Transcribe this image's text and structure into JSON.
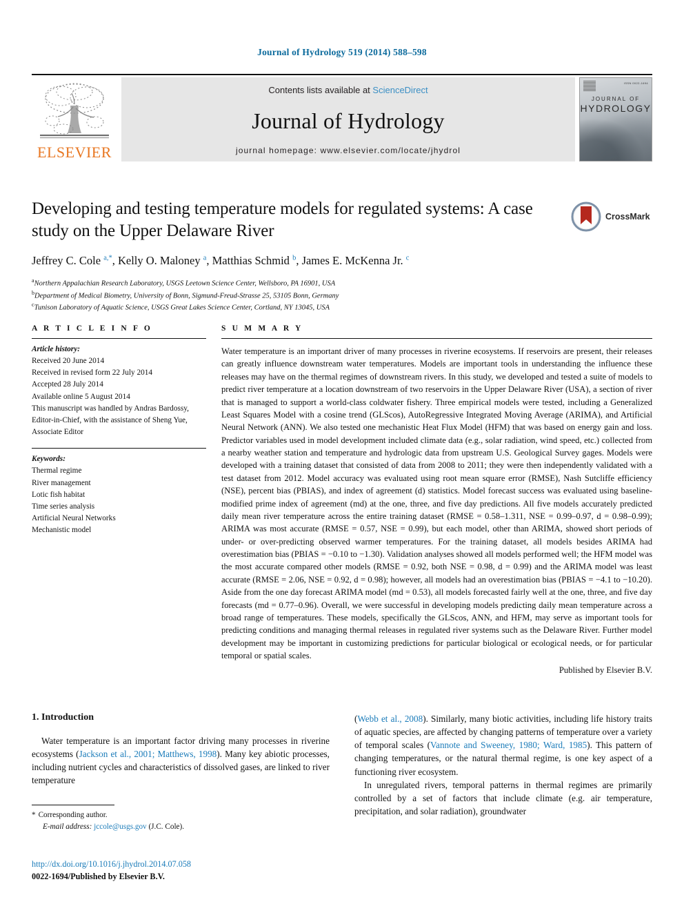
{
  "running_head": "Journal of Hydrology 519 (2014) 588–598",
  "masthead": {
    "contents_prefix": "Contents lists available at",
    "sciencedirect": "ScienceDirect",
    "journal_name": "Journal of Hydrology",
    "homepage": "journal homepage: www.elsevier.com/locate/jhydrol",
    "publisher_logo_text": "ELSEVIER",
    "cover": {
      "line1": "JOURNAL OF",
      "line2": "HYDROLOGY",
      "code": "ISSN 0022-1694"
    },
    "link_color": "#3b8fc4",
    "elsevier_orange": "#E87722"
  },
  "article": {
    "title": "Developing and testing temperature models for regulated systems: A case study on the Upper Delaware River",
    "authors_html": "Jeffrey C. Cole <sup>a,*</sup>, Kelly O. Maloney <sup>a</sup>, Matthias Schmid <sup>b</sup>, James E. McKenna Jr. <sup>c</sup>",
    "affiliations": [
      {
        "marker": "a",
        "text": "Northern Appalachian Research Laboratory, USGS Leetown Science Center, Wellsboro, PA 16901, USA"
      },
      {
        "marker": "b",
        "text": "Department of Medical Biometry, University of Bonn, Sigmund-Freud-Strasse 25, 53105 Bonn, Germany"
      },
      {
        "marker": "c",
        "text": "Tunison Laboratory of Aquatic Science, USGS Great Lakes Science Center, Cortland, NY 13045, USA"
      }
    ],
    "crossmark_label": "CrossMark"
  },
  "article_info": {
    "heading": "A R T I C L E   I N F O",
    "history_label": "Article history:",
    "history": [
      "Received 20 June 2014",
      "Received in revised form 22 July 2014",
      "Accepted 28 July 2014",
      "Available online 5 August 2014",
      "This manuscript was handled by Andras Bardossy, Editor-in-Chief, with the assistance of Sheng Yue, Associate Editor"
    ],
    "keywords_label": "Keywords:",
    "keywords": [
      "Thermal regime",
      "River management",
      "Lotic fish habitat",
      "Time series analysis",
      "Artificial Neural Networks",
      "Mechanistic model"
    ]
  },
  "summary": {
    "heading": "S U M M A R Y",
    "text": "Water temperature is an important driver of many processes in riverine ecosystems. If reservoirs are present, their releases can greatly influence downstream water temperatures. Models are important tools in understanding the influence these releases may have on the thermal regimes of downstream rivers. In this study, we developed and tested a suite of models to predict river temperature at a location downstream of two reservoirs in the Upper Delaware River (USA), a section of river that is managed to support a world-class coldwater fishery. Three empirical models were tested, including a Generalized Least Squares Model with a cosine trend (GLScos), AutoRegressive Integrated Moving Average (ARIMA), and Artificial Neural Network (ANN). We also tested one mechanistic Heat Flux Model (HFM) that was based on energy gain and loss. Predictor variables used in model development included climate data (e.g., solar radiation, wind speed, etc.) collected from a nearby weather station and temperature and hydrologic data from upstream U.S. Geological Survey gages. Models were developed with a training dataset that consisted of data from 2008 to 2011; they were then independently validated with a test dataset from 2012. Model accuracy was evaluated using root mean square error (RMSE), Nash Sutcliffe efficiency (NSE), percent bias (PBIAS), and index of agreement (d) statistics. Model forecast success was evaluated using baseline-modified prime index of agreement (md) at the one, three, and five day predictions. All five models accurately predicted daily mean river temperature across the entire training dataset (RMSE = 0.58–1.311, NSE = 0.99–0.97, d = 0.98–0.99); ARIMA was most accurate (RMSE = 0.57, NSE = 0.99), but each model, other than ARIMA, showed short periods of under- or over-predicting observed warmer temperatures. For the training dataset, all models besides ARIMA had overestimation bias (PBIAS = −0.10 to −1.30). Validation analyses showed all models performed well; the HFM model was the most accurate compared other models (RMSE = 0.92, both NSE = 0.98, d = 0.99) and the ARIMA model was least accurate (RMSE = 2.06, NSE = 0.92, d = 0.98); however, all models had an overestimation bias (PBIAS = −4.1 to −10.20). Aside from the one day forecast ARIMA model (md = 0.53), all models forecasted fairly well at the one, three, and five day forecasts (md = 0.77–0.96). Overall, we were successful in developing models predicting daily mean temperature across a broad range of temperatures. These models, specifically the GLScos, ANN, and HFM, may serve as important tools for predicting conditions and managing thermal releases in regulated river systems such as the Delaware River. Further model development may be important in customizing predictions for particular biological or ecological needs, or for particular temporal or spatial scales.",
    "published_by": "Published by Elsevier B.V."
  },
  "introduction": {
    "heading": "1. Introduction",
    "left_paragraph_1_a": "Water temperature is an important factor driving many processes in riverine ecosystems (",
    "left_cite_1": "Jackson et al., 2001; Matthews, 1998",
    "left_paragraph_1_b": "). Many key abiotic processes, including nutrient cycles and characteristics of dissolved gases, are linked to river temperature",
    "right_cite_1": "Webb et al., 2008",
    "right_paragraph_1_a": "). Similarly, many biotic activities, including life history traits of aquatic species, are affected by changing patterns of temperature over a variety of temporal scales (",
    "right_cite_2": "Vannote and Sweeney, 1980; Ward, 1985",
    "right_paragraph_1_b": "). This pattern of changing temperatures, or the natural thermal regime, is one key aspect of a functioning river ecosystem.",
    "right_paragraph_2": "In unregulated rivers, temporal patterns in thermal regimes are primarily controlled by a set of factors that include climate (e.g. air temperature, precipitation, and solar radiation), groundwater"
  },
  "footnote": {
    "corresponding": "Corresponding author.",
    "email_label": "E-mail address:",
    "email": "jccole@usgs.gov",
    "email_owner": "(J.C. Cole)."
  },
  "colophon": {
    "doi": "http://dx.doi.org/10.1016/j.jhydrol.2014.07.058",
    "issn": "0022-1694/Published by Elsevier B.V."
  }
}
